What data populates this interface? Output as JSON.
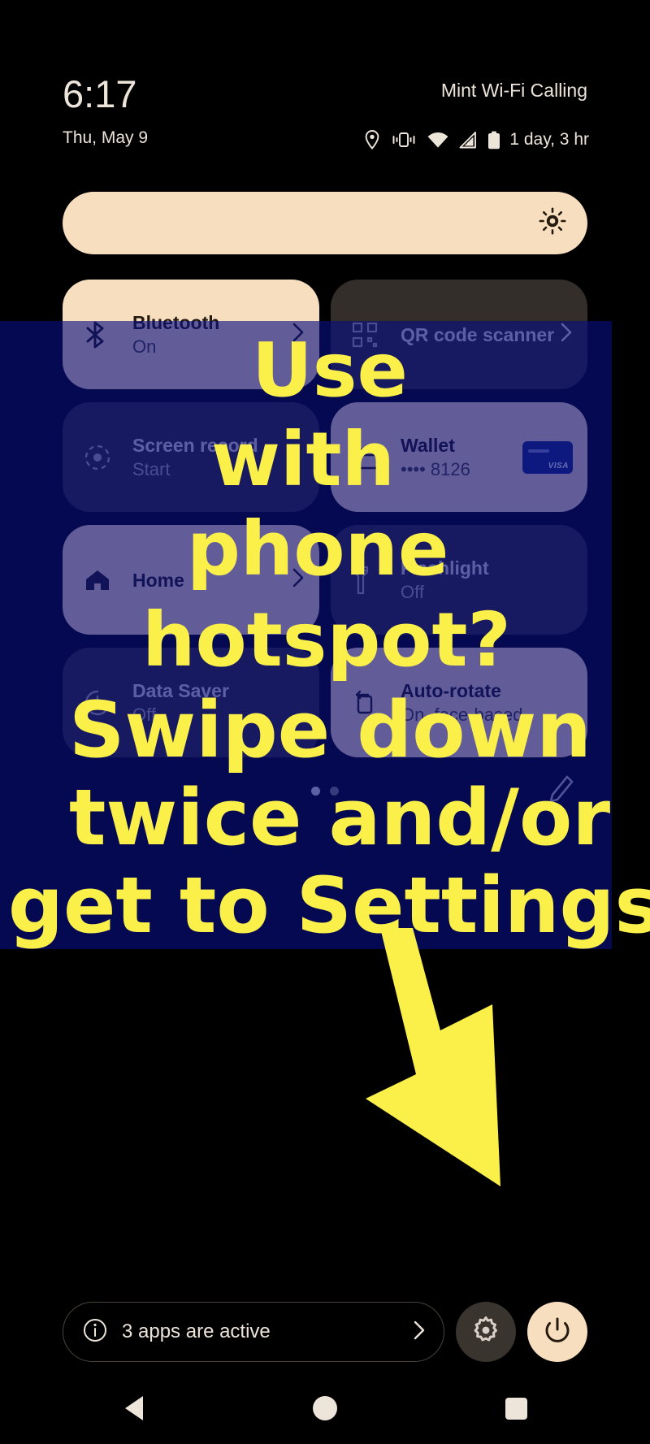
{
  "statusbar": {
    "clock": "6:17",
    "date": "Thu, May 9",
    "carrier": "Mint Wi-Fi Calling",
    "battery_estimate": "1 day, 3 hr",
    "icons": [
      "location-icon",
      "vibrate-icon",
      "wifi-icon",
      "cell-signal-icon",
      "battery-icon"
    ]
  },
  "brightness": {
    "icon": "brightness-auto-icon",
    "level_percent": 100
  },
  "tiles": [
    {
      "name": "Bluetooth",
      "sub": "On",
      "state": "on",
      "icon": "bluetooth-icon",
      "chevron": true,
      "extra": ""
    },
    {
      "name": "QR code scanner",
      "sub": "",
      "state": "off",
      "icon": "qr-code-icon",
      "chevron": true,
      "extra": ""
    },
    {
      "name": "Screen record",
      "sub": "Start",
      "state": "off",
      "icon": "screen-record-icon",
      "chevron": false,
      "extra": ""
    },
    {
      "name": "Wallet",
      "sub": "•••• 8126",
      "state": "on",
      "icon": "wallet-icon",
      "chevron": false,
      "extra": "visa-card"
    },
    {
      "name": "Home",
      "sub": "",
      "state": "on",
      "icon": "home-icon",
      "chevron": true,
      "extra": ""
    },
    {
      "name": "Flashlight",
      "sub": "Off",
      "state": "off",
      "icon": "flashlight-icon",
      "chevron": false,
      "extra": ""
    },
    {
      "name": "Data Saver",
      "sub": "Off",
      "state": "off",
      "icon": "data-saver-icon",
      "chevron": false,
      "extra": ""
    },
    {
      "name": "Auto-rotate",
      "sub": "On, face-based",
      "state": "on",
      "icon": "auto-rotate-icon",
      "chevron": false,
      "extra": ""
    }
  ],
  "pager": {
    "pages": 2,
    "active_page": 1
  },
  "edit": {
    "icon": "pencil-icon"
  },
  "footer": {
    "info_icon": "info-icon",
    "active_apps_label": "3 apps are active",
    "chevron_icon": "chevron-right-icon",
    "settings_icon": "gear-icon",
    "power_icon": "power-icon"
  },
  "navbar": {
    "back": "back-triangle-icon",
    "home": "home-circle-icon",
    "recents": "recents-square-icon"
  },
  "annotation": {
    "color": "#FBF04A",
    "overlay_color": "#060E82",
    "lines": [
      "Use",
      "with",
      "phone",
      "hotspot?",
      "Swipe down",
      "twice and/or",
      "get to Settings."
    ],
    "arrow": "down-right-arrow"
  }
}
